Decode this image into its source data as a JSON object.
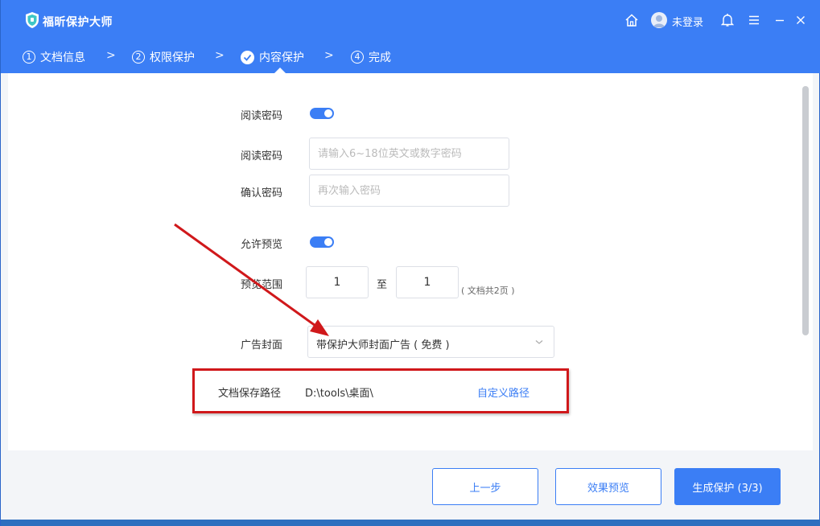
{
  "header": {
    "app_title": "福昕保护大师",
    "login_text": "未登录"
  },
  "steps": [
    {
      "num": "1",
      "label": "文档信息"
    },
    {
      "num": "2",
      "label": "权限保护"
    },
    {
      "num": "",
      "label": "内容保护"
    },
    {
      "num": "4",
      "label": "完成"
    }
  ],
  "step_separator": ">",
  "form": {
    "read_password_toggle_label": "阅读密码",
    "read_password_toggle_on": true,
    "read_password_label": "阅读密码",
    "read_password_placeholder": "请输入6~18位英文或数字密码",
    "confirm_password_label": "确认密码",
    "confirm_password_placeholder": "再次输入密码",
    "allow_preview_label": "允许预览",
    "allow_preview_on": true,
    "preview_range_label": "预览范围",
    "preview_from": "1",
    "preview_to_word": "至",
    "preview_to": "1",
    "preview_note": "( 文档共2页 )",
    "ad_cover_label": "广告封面",
    "ad_cover_value": "带保护大师封面广告 ( 免费 )",
    "save_path_label": "文档保存路径",
    "save_path_value": "D:\\tools\\桌面\\",
    "custom_path_link": "自定义路径"
  },
  "footer": {
    "prev_label": "上一步",
    "preview_label": "效果预览",
    "generate_label": "生成保护 (3/3)"
  },
  "colors": {
    "accent": "#3b7ef5",
    "highlight_red": "#d0181b"
  }
}
